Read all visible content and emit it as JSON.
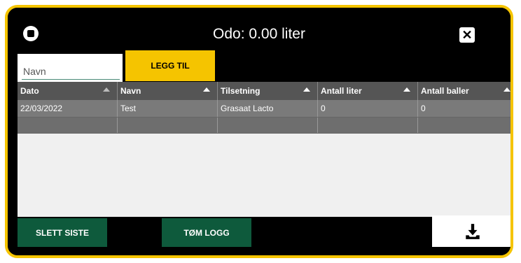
{
  "header": {
    "title": "Odo: 0.00 liter",
    "stop_icon": "stop-circle-icon",
    "close_icon": "close-icon"
  },
  "form": {
    "name_placeholder": "Navn",
    "add_label": "LEGG TIL"
  },
  "table": {
    "columns": [
      "Dato",
      "Navn",
      "Tilsetning",
      "Antall liter",
      "Antall baller"
    ],
    "rows": [
      [
        "22/03/2022",
        "Test",
        "Grasaat Lacto",
        "0",
        "0"
      ]
    ]
  },
  "footer": {
    "delete_last_label": "SLETT SISTE",
    "clear_log_label": "TØM LOGG",
    "download_icon": "download-icon"
  },
  "colors": {
    "accent": "#f5c400",
    "button_green": "#0e5a3c",
    "header_gray": "#555555"
  }
}
